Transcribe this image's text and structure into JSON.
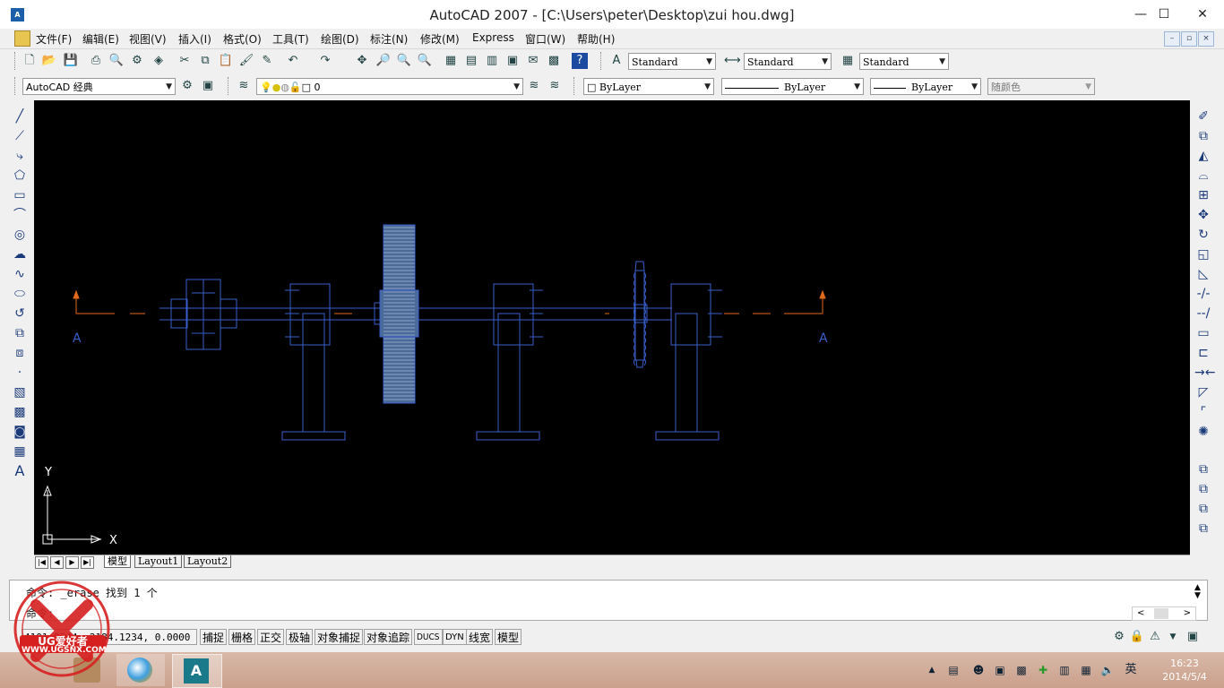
{
  "window": {
    "title": "AutoCAD 2007 - [C:\\Users\\peter\\Desktop\\zui hou.dwg]",
    "app_icon_text": "A"
  },
  "menu": [
    "文件(F)",
    "编辑(E)",
    "视图(V)",
    "插入(I)",
    "格式(O)",
    "工具(T)",
    "绘图(D)",
    "标注(N)",
    "修改(M)",
    "Express",
    "窗口(W)",
    "帮助(H)"
  ],
  "styles_toolbar": {
    "text_style": "Standard",
    "dim_style": "Standard",
    "table_style": "Standard"
  },
  "layers_toolbar": {
    "workspace": "AutoCAD 经典",
    "current_layer": "0",
    "color": "ByLayer",
    "linetype": "ByLayer",
    "lineweight": "ByLayer",
    "plot_style": "随颜色"
  },
  "drawing": {
    "section_label": "A",
    "ucs_x": "X",
    "ucs_y": "Y"
  },
  "tabs": [
    "模型",
    "Layout1",
    "Layout2"
  ],
  "command": {
    "line1": "命令:  _erase 找到 1 个",
    "line2": "命令:"
  },
  "status": {
    "coords": "4101.2344, 2184.1234, 0.0000",
    "buttons": [
      "捕捉",
      "栅格",
      "正交",
      "极轴",
      "对象捕捉",
      "对象追踪",
      "DUCS",
      "DYN",
      "线宽",
      "模型"
    ]
  },
  "taskbar": {
    "time": "16:23",
    "date": "2014/5/4",
    "ime": "英"
  },
  "watermark": {
    "text": "UG爱好者",
    "url": "WWW.UGSNX.COM"
  },
  "colors": {
    "canvas": "#000000",
    "geometry": "#3a5fcd",
    "centerline": "#e06a1a",
    "gear_fill": "#4a6a9a"
  }
}
